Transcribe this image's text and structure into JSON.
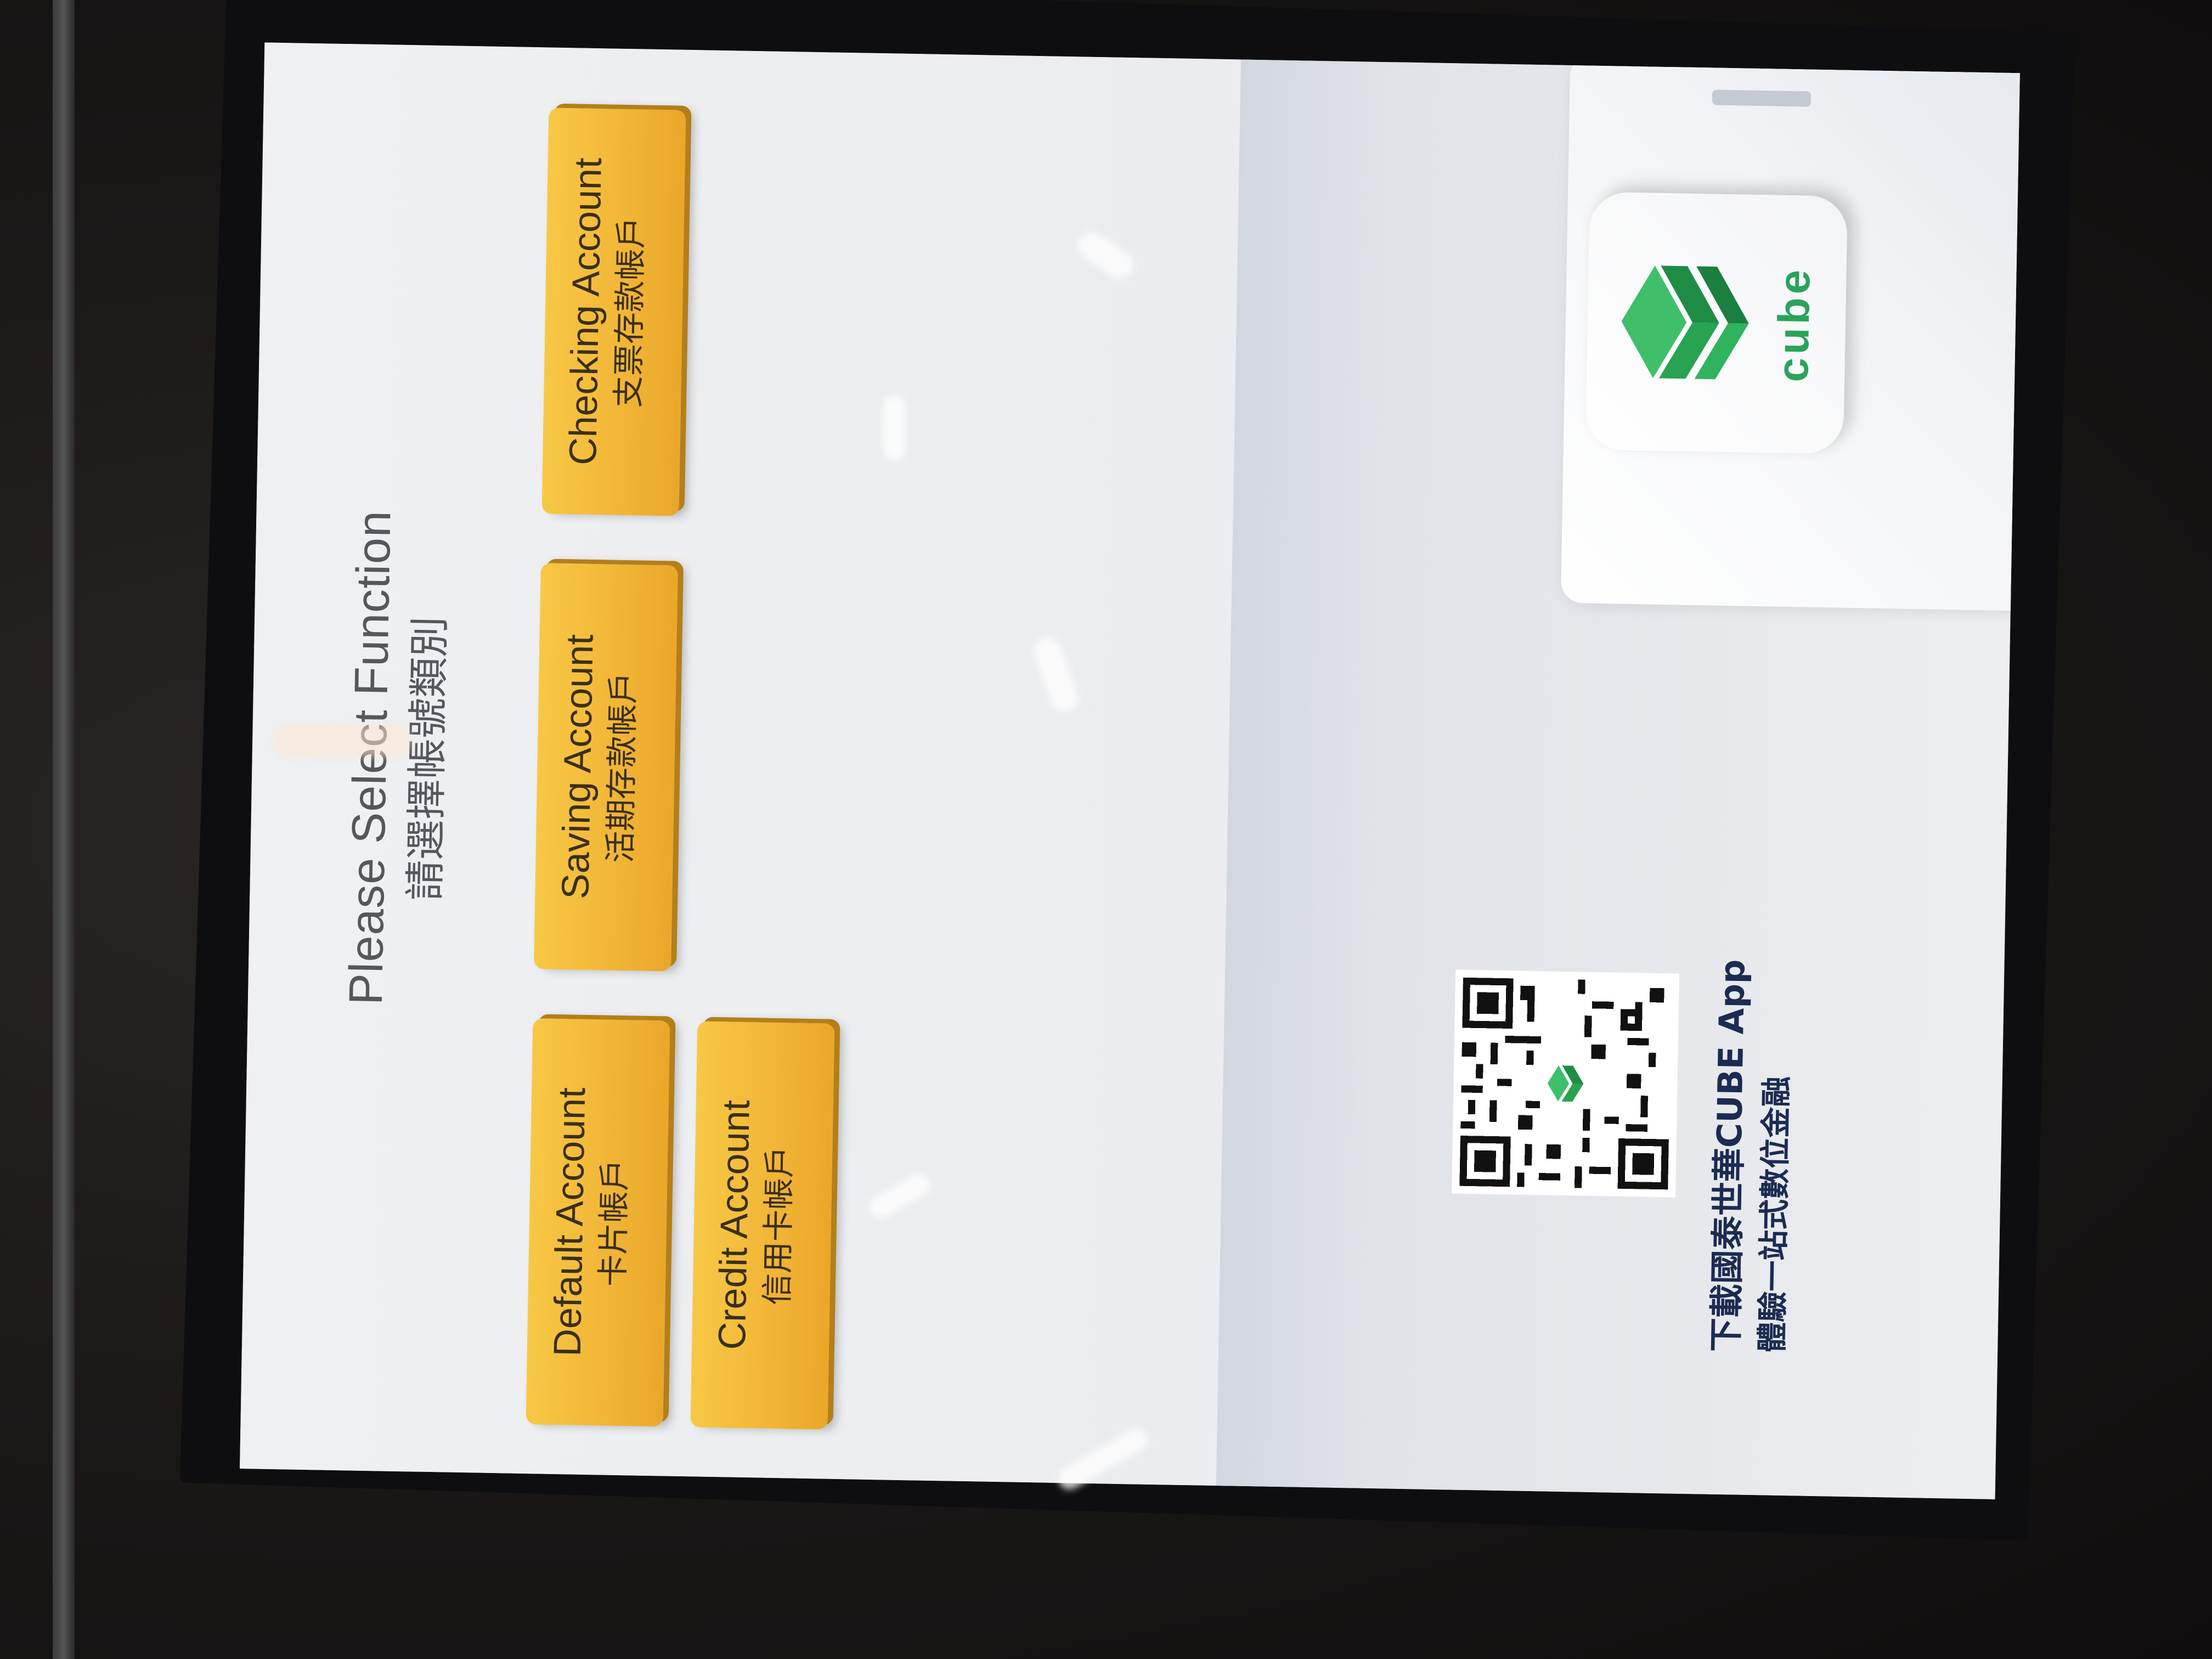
{
  "screen": {
    "title_en": "Please Select Function",
    "title_zh": "請選擇帳號類別"
  },
  "buttons": {
    "default_account": {
      "label_en": "Default Account",
      "label_zh": "卡片帳戶"
    },
    "saving_account": {
      "label_en": "Saving Account",
      "label_zh": "活期存款帳戶"
    },
    "checking_account": {
      "label_en": "Checking Account",
      "label_zh": "支票存款帳戶"
    },
    "credit_account": {
      "label_en": "Credit Account",
      "label_zh": "信用卡帳戶"
    }
  },
  "promo": {
    "line1": "下載國泰世華CUBE App",
    "line2": "體驗一站式數位金融",
    "app_name": "cube",
    "qr_icon": "qr-code-icon",
    "logo_icon": "cube-leaf-logo-icon"
  },
  "colors": {
    "button_yellow": "#f2b637",
    "brand_green": "#2aa35b",
    "text_navy": "#1c2b52"
  }
}
